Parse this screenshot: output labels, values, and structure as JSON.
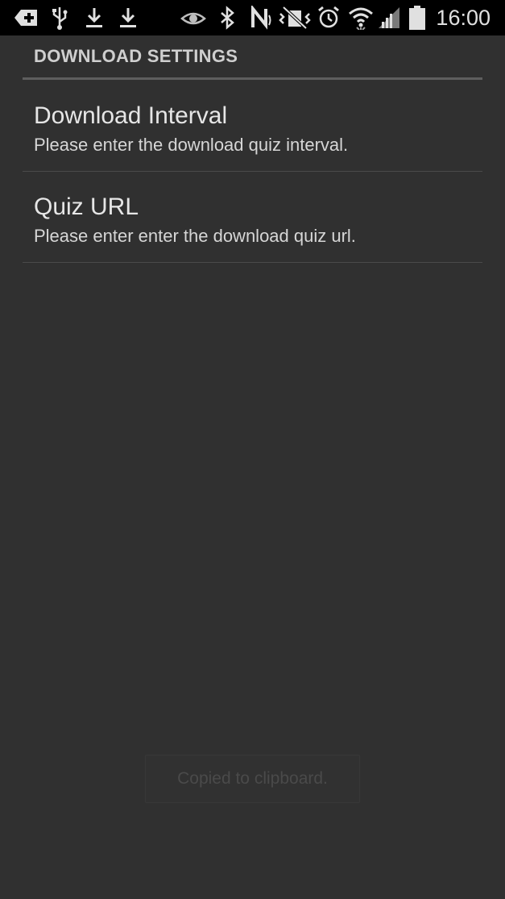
{
  "status_bar": {
    "time": "16:00",
    "icons": [
      "add-box-icon",
      "usb-icon",
      "download-icon",
      "download-icon",
      "eye-icon",
      "bluetooth-icon",
      "nfc-icon",
      "vibrate-mute-icon",
      "alarm-icon",
      "wifi-icon",
      "signal-icon",
      "battery-icon"
    ]
  },
  "section": {
    "title": "DOWNLOAD SETTINGS"
  },
  "preferences": [
    {
      "title": "Download Interval",
      "summary": "Please enter the download quiz interval."
    },
    {
      "title": "Quiz URL",
      "summary": "Please enter enter the download quiz url."
    }
  ],
  "toast": {
    "message": "Copied to clipboard."
  },
  "colors": {
    "background": "#303030",
    "status_bar": "#000000",
    "text_primary": "#e6e6e6",
    "divider": "#4a4a4a"
  }
}
